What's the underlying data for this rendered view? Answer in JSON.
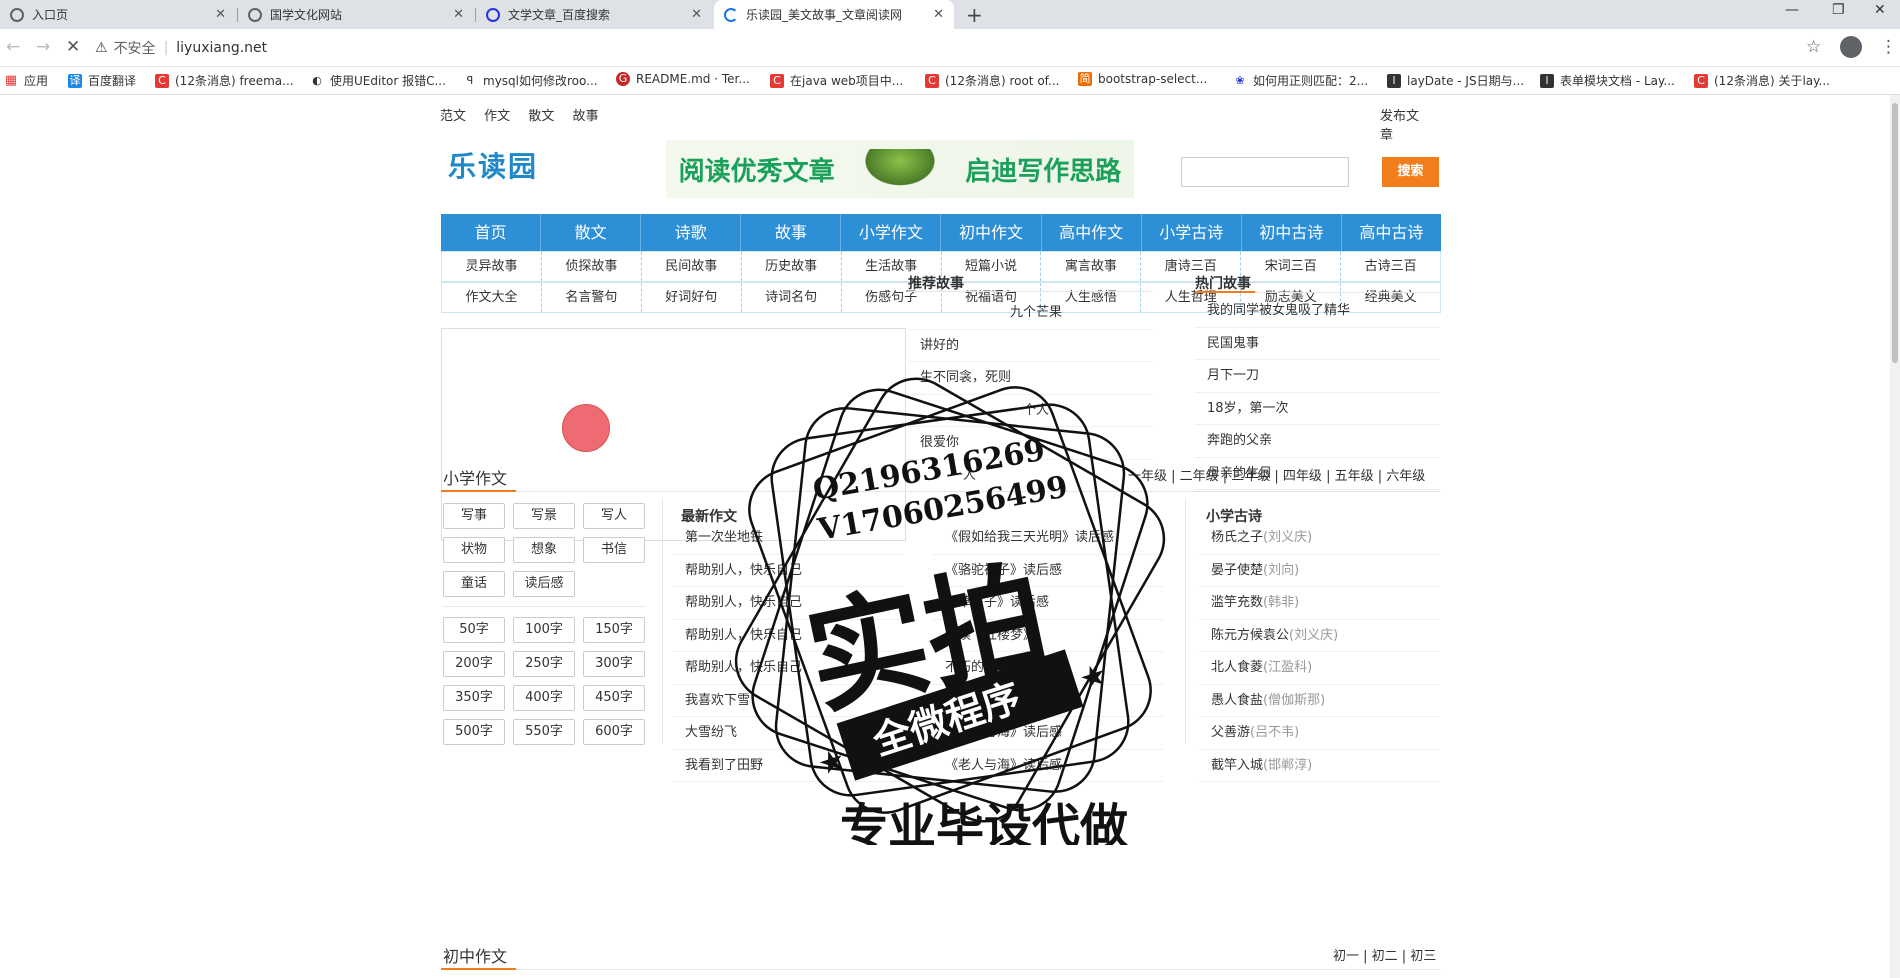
{
  "browser": {
    "tabs": [
      {
        "title": "入口页"
      },
      {
        "title": "国学文化网站"
      },
      {
        "title": "文学文章_百度搜索"
      },
      {
        "title": "乐读园_美文故事_文章阅读网"
      }
    ],
    "address": {
      "security": "不安全",
      "url": "liyuxiang.net"
    },
    "bookmarks": [
      {
        "label": "应用"
      },
      {
        "label": "百度翻译"
      },
      {
        "label": "(12条消息) freema..."
      },
      {
        "label": "使用UEditor 报错C..."
      },
      {
        "label": "mysql如何修改roo..."
      },
      {
        "label": "README.md · Ter..."
      },
      {
        "label": "在java web项目中..."
      },
      {
        "label": "(12条消息) root of..."
      },
      {
        "label": "bootstrap-select..."
      },
      {
        "label": "如何用正则匹配：2..."
      },
      {
        "label": "layDate - JS日期与..."
      },
      {
        "label": "表单模块文档 - Lay..."
      },
      {
        "label": "(12条消息) 关于lay..."
      }
    ]
  },
  "site": {
    "topnav": [
      "范文",
      "作文",
      "散文",
      "故事"
    ],
    "publish": "发布文章",
    "logo": "乐读园",
    "banner_left": "阅读优秀文章",
    "banner_right": "启迪写作思路",
    "search_btn": "搜索",
    "main_nav": [
      "首页",
      "散文",
      "诗歌",
      "故事",
      "小学作文",
      "初中作文",
      "高中作文",
      "小学古诗",
      "初中古诗",
      "高中古诗"
    ],
    "sub_nav_1": [
      "灵异故事",
      "侦探故事",
      "民间故事",
      "历史故事",
      "生活故事",
      "短篇小说",
      "寓言故事",
      "唐诗三百",
      "宋词三百",
      "古诗三百"
    ],
    "sub_nav_2": [
      "作文大全",
      "名言警句",
      "好词好句",
      "诗词名句",
      "伤感句子",
      "祝福语句",
      "人生感悟",
      "人生哲理",
      "励志美文",
      "经典美文"
    ],
    "recommend": {
      "title": "推荐故事",
      "items": [
        "九个芒果",
        "讲好的",
        "生不同衾，死则",
        "一个人",
        "很爱你",
        "一人"
      ]
    },
    "hot": {
      "title": "热门故事",
      "items": [
        "我的同学被女鬼吸了精华",
        "民国鬼事",
        "月下一刀",
        "18岁，第一次",
        "奔跑的父亲",
        "母亲的生日"
      ]
    },
    "primary": {
      "title": "小学作文",
      "grades": "一年级 | 二年级 | 三年级 | 四年级 | 五年级 | 六年级",
      "tags": [
        "写事",
        "写景",
        "写人",
        "状物",
        "想象",
        "书信",
        "童话",
        "读后感"
      ],
      "wordcounts": [
        "50字",
        "100字",
        "150字",
        "200字",
        "250字",
        "300字",
        "350字",
        "400字",
        "450字",
        "500字",
        "550字",
        "600字"
      ],
      "latest_title": "最新作文",
      "latest_a": [
        "第一次坐地铁",
        "帮助别人，快乐自己",
        "帮助别人，快乐自己",
        "帮助别人，快乐自己",
        "帮助别人，快乐自己",
        "我喜欢下雪",
        "大雪纷飞",
        "我看到了田野"
      ],
      "latest_b": [
        "《假如给我三天光明》读后感",
        "《骆驼祥子》读后感",
        "《草房子》读后感",
        "我读《红楼梦》",
        "不朽的经典",
        "《骆驼祥子》读后感",
        "《老人与海》读后感",
        "《老人与海》读后感"
      ],
      "poems_title": "小学古诗",
      "poems": [
        {
          "t": "杨氏之子",
          "a": "(刘义庆)"
        },
        {
          "t": "晏子使楚",
          "a": "(刘向)"
        },
        {
          "t": "滥竽充数",
          "a": "(韩非)"
        },
        {
          "t": "陈元方候袁公",
          "a": "(刘义庆)"
        },
        {
          "t": "北人食菱",
          "a": "(江盈科)"
        },
        {
          "t": "愚人食盐",
          "a": "(僧伽斯那)"
        },
        {
          "t": "父善游",
          "a": "(吕不韦)"
        },
        {
          "t": "截竿入城",
          "a": "(邯郸淳)"
        }
      ]
    },
    "junior": {
      "title": "初中作文",
      "grades": "初一 | 初二 | 初三"
    },
    "watermark": {
      "line1": "Q2196316269",
      "line2": "V17060256499",
      "big": "实拍",
      "band": "全微程序",
      "bottom": "专业毕设代做"
    }
  }
}
